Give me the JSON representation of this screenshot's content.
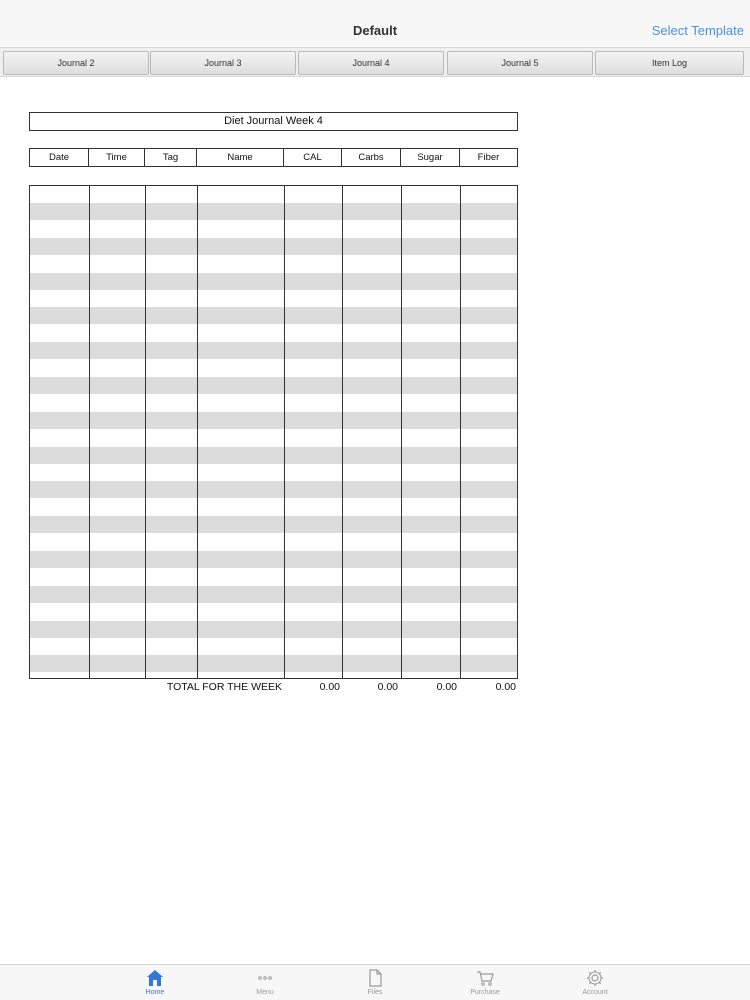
{
  "navbar": {
    "title": "Default",
    "action_label": "Select Template",
    "accent": "#4a90e2"
  },
  "segments": [
    "Journal 2",
    "Journal 3",
    "Journal 4",
    "Journal 5",
    "Item Log"
  ],
  "sheet": {
    "title": "Diet Journal Week 4",
    "columns": [
      "Date",
      "Time",
      "Tag",
      "Name",
      "CAL",
      "Carbs",
      "Sugar",
      "Fiber"
    ],
    "totals_label": "TOTAL FOR THE WEEK",
    "totals": {
      "cal": "0.00",
      "carbs": "0.00",
      "sugar": "0.00",
      "fiber": "0.00"
    }
  },
  "bottom_tabs": [
    {
      "label": "Home",
      "icon": "home-icon",
      "active": true
    },
    {
      "label": "Menu",
      "icon": "more-dots-icon",
      "active": false
    },
    {
      "label": "Files",
      "icon": "file-icon",
      "active": false
    },
    {
      "label": "Purchase",
      "icon": "cart-icon",
      "active": false
    },
    {
      "label": "Account",
      "icon": "gear-icon",
      "active": false
    }
  ]
}
